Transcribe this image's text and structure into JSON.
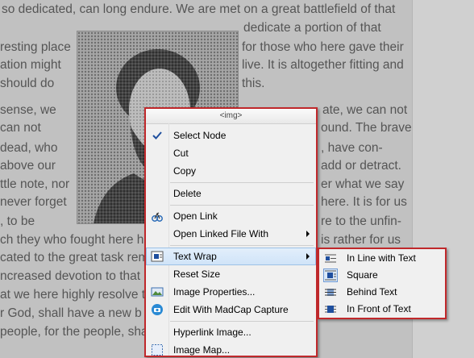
{
  "document": {
    "lines": [
      {
        "text": "so dedicated, can long endure. We are met on a great battlefield of that"
      },
      {
        "text": "resting place"
      },
      {
        "text": "ation might"
      },
      {
        "text": "should do"
      },
      {
        "text": "sense, we"
      },
      {
        "text": "can not"
      },
      {
        "text": "dead, who"
      },
      {
        "text": "above our"
      },
      {
        "text": "ttle note, nor"
      },
      {
        "text": "never forget"
      },
      {
        "text": ", to be"
      },
      {
        "text": "ch they who fought here ha"
      },
      {
        "text": "cated to the great task rem"
      },
      {
        "text": "ncreased devotion to that c"
      },
      {
        "text": "at we here highly resolve th"
      },
      {
        "text": "r God, shall have a new b"
      },
      {
        "text": "people, for the people, sha"
      },
      {
        "text": "dedicate a portion of that"
      },
      {
        "text": " for those who here gave their"
      },
      {
        "text": "live. It is altogether fitting and"
      },
      {
        "text": "this."
      },
      {
        "text": "ate, we can not"
      },
      {
        "text": "ound. The brave"
      },
      {
        "text": ", have con-"
      },
      {
        "text": " add or detract."
      },
      {
        "text": "er what we say"
      },
      {
        "text": "here. It is for us"
      },
      {
        "text": "re to the unfin-"
      },
      {
        "text": "is rather for us"
      }
    ]
  },
  "context_menu": {
    "header": "<img>",
    "items": [
      {
        "label": "Select Node",
        "icon": "checkmark-icon"
      },
      {
        "label": "Cut"
      },
      {
        "label": "Copy"
      },
      {
        "label": "Delete"
      },
      {
        "label": "Open Link",
        "icon": "open-link-icon"
      },
      {
        "label": "Open Linked File With",
        "submenu": true
      },
      {
        "label": "Text Wrap",
        "icon": "text-wrap-icon",
        "submenu": true,
        "highlighted": true
      },
      {
        "label": "Reset Size"
      },
      {
        "label": "Image Properties...",
        "icon": "image-properties-icon"
      },
      {
        "label": "Edit With MadCap Capture",
        "icon": "madcap-capture-icon"
      },
      {
        "label": "Hyperlink Image..."
      },
      {
        "label": "Image Map...",
        "icon": "image-map-icon"
      }
    ]
  },
  "text_wrap_submenu": {
    "items": [
      {
        "label": "In Line with Text",
        "icon": "inline-with-text-icon"
      },
      {
        "label": "Square",
        "icon": "square-wrap-icon",
        "selected": true
      },
      {
        "label": "Behind Text",
        "icon": "behind-text-icon"
      },
      {
        "label": "In Front of Text",
        "icon": "in-front-of-text-icon"
      }
    ]
  },
  "colors": {
    "callout_border": "#c0282b",
    "menu_background": "#f0f0f0",
    "highlight": "#cfe3f8",
    "dimmed_page": "#c1c1c1"
  }
}
